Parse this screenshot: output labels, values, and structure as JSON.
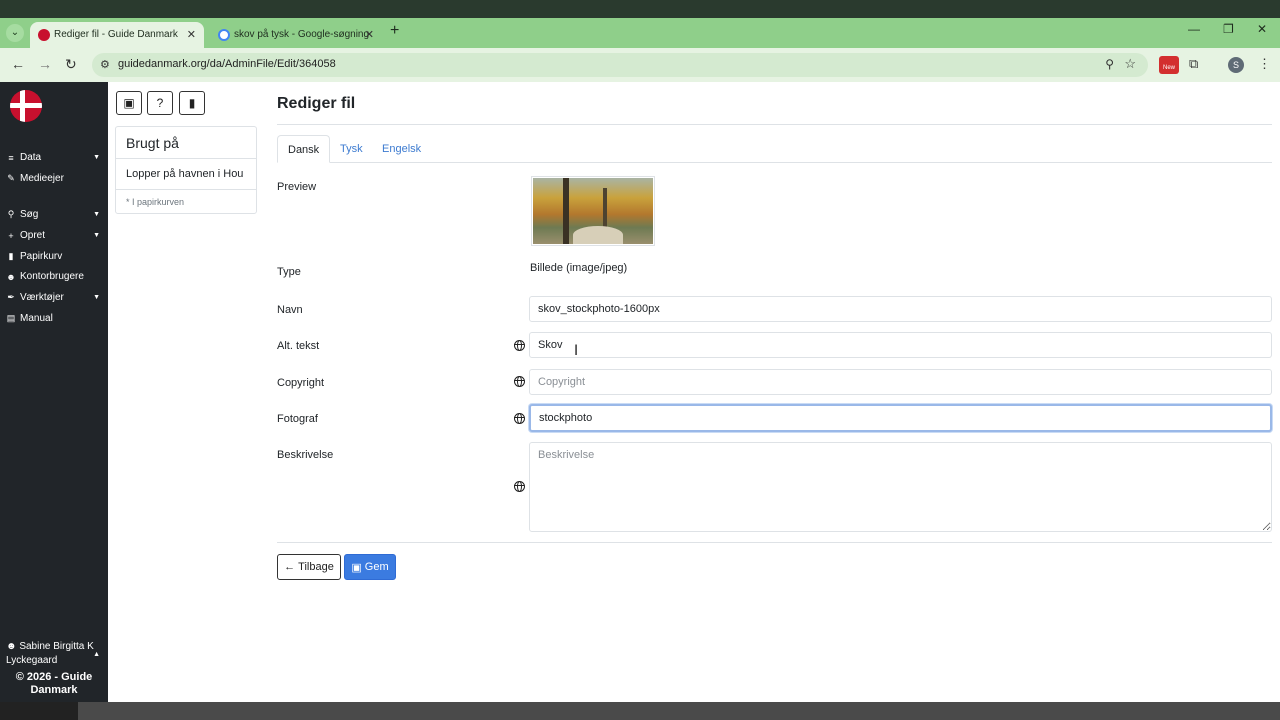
{
  "browser": {
    "tabs": [
      {
        "title": "Rediger fil - Guide Danmark",
        "active": true
      },
      {
        "title": "skov på tysk - Google-søgning",
        "active": false
      }
    ],
    "url": "guidedanmark.org/da/AdminFile/Edit/364058",
    "ext_new_badge": "New",
    "profile_initial": "S"
  },
  "sidebar": {
    "items": [
      {
        "label": "Data",
        "icon": "database-icon",
        "has_caret": true
      },
      {
        "label": "Medieejer",
        "icon": "edit-icon",
        "has_caret": false
      },
      {
        "label": "Søg",
        "icon": "search-icon",
        "has_caret": true
      },
      {
        "label": "Opret",
        "icon": "plus-icon",
        "has_caret": true
      },
      {
        "label": "Papirkurv",
        "icon": "trash-icon",
        "has_caret": false
      },
      {
        "label": "Kontorbrugere",
        "icon": "users-icon",
        "has_caret": false
      },
      {
        "label": "Værktøjer",
        "icon": "wrench-icon",
        "has_caret": true
      },
      {
        "label": "Manual",
        "icon": "book-icon",
        "has_caret": false
      }
    ],
    "user": "Sabine Birgitta K Lyckegaard",
    "footer": "© 2026 - Guide Danmark"
  },
  "used_in": {
    "title": "Brugt på",
    "items": [
      "Lopper på havnen i Hou"
    ],
    "note": "* I papirkurven"
  },
  "page": {
    "title": "Rediger fil",
    "tabs": [
      "Dansk",
      "Tysk",
      "Engelsk"
    ],
    "active_tab": "Dansk"
  },
  "form": {
    "preview_label": "Preview",
    "type_label": "Type",
    "type_value": "Billede (image/jpeg)",
    "name_label": "Navn",
    "name_value": "skov_stockphoto-1600px",
    "alt_label": "Alt. tekst",
    "alt_value": "Skov",
    "copyright_label": "Copyright",
    "copyright_value": "",
    "copyright_placeholder": "Copyright",
    "photographer_label": "Fotograf",
    "photographer_value": "stockphoto",
    "description_label": "Beskrivelse",
    "description_value": "",
    "description_placeholder": "Beskrivelse"
  },
  "actions": {
    "back_label": "Tilbage",
    "save_label": "Gem"
  },
  "colors": {
    "sidebar_bg": "#212529",
    "primary": "#3b7be0",
    "tab_link": "#3d7bd0",
    "browser_tabbar": "#8fcf8a"
  }
}
